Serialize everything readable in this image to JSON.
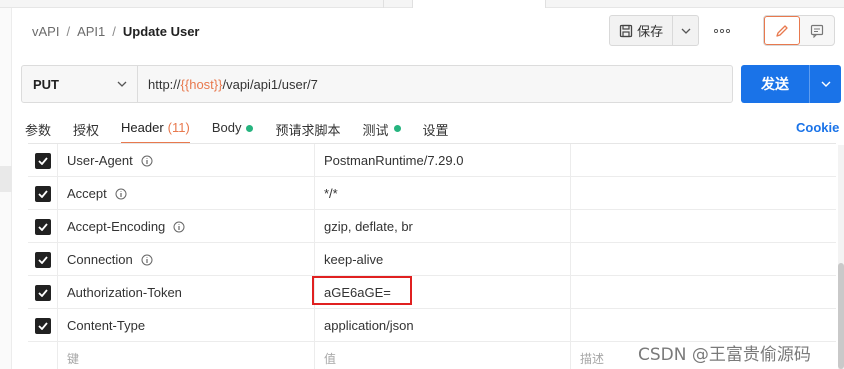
{
  "breadcrumb": {
    "items": [
      "vAPI",
      "API1"
    ],
    "separator": "/",
    "current": "Update User"
  },
  "toolbar": {
    "save_label": "保存",
    "more_icon": "more-horizontal-icon",
    "edit_icon": "pencil-icon",
    "comment_icon": "comment-icon"
  },
  "request": {
    "method": "PUT",
    "url_prefix": "http://",
    "url_var": "{{host}}",
    "url_suffix": "/vapi/api1/user/7",
    "send_label": "发送"
  },
  "tabs": [
    {
      "label": "参数"
    },
    {
      "label": "授权"
    },
    {
      "label": "Header",
      "count": "(11)",
      "active": true
    },
    {
      "label": "Body",
      "dot": true
    },
    {
      "label": "预请求脚本"
    },
    {
      "label": "测试",
      "dot": true
    },
    {
      "label": "设置"
    }
  ],
  "cookies_label": "Cookie",
  "headers": [
    {
      "key": "User-Agent",
      "value": "PostmanRuntime/7.29.0",
      "checked": true
    },
    {
      "key": "Accept",
      "value": "*/*",
      "checked": true
    },
    {
      "key": "Accept-Encoding",
      "value": "gzip, deflate, br",
      "checked": true
    },
    {
      "key": "Connection",
      "value": "keep-alive",
      "checked": true
    },
    {
      "key": "Authorization-Token",
      "value": "aGE6aGE=",
      "checked": true
    },
    {
      "key": "Content-Type",
      "value": "application/json",
      "checked": true
    }
  ],
  "empty_row": {
    "key_placeholder": "键",
    "value_placeholder": "值",
    "desc_placeholder": "描述"
  },
  "watermark": "CSDN @王富贵偷源码",
  "colors": {
    "accent": "#e8794e",
    "primary": "#1a73e8",
    "status_dot": "#26b47f",
    "highlight": "#e02020"
  }
}
